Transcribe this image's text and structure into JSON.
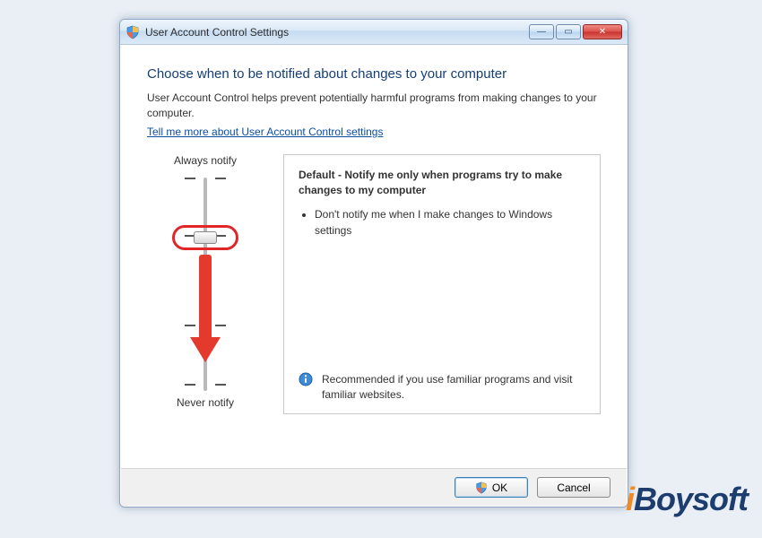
{
  "window": {
    "title": "User Account Control Settings"
  },
  "main": {
    "heading": "Choose when to be notified about changes to your computer",
    "description": "User Account Control helps prevent potentially harmful programs from making changes to your computer.",
    "link": "Tell me more about User Account Control settings"
  },
  "slider": {
    "top_label": "Always notify",
    "bottom_label": "Never notify",
    "levels": 4,
    "current_level": 1
  },
  "panel": {
    "title": "Default - Notify me only when programs try to make changes to my computer",
    "bullets": [
      "Don't notify me when I make changes to Windows settings"
    ],
    "footer": "Recommended if you use familiar programs and visit familiar websites."
  },
  "buttons": {
    "ok": "OK",
    "cancel": "Cancel"
  },
  "watermark": {
    "prefix": "i",
    "brand": "Boysoft"
  }
}
